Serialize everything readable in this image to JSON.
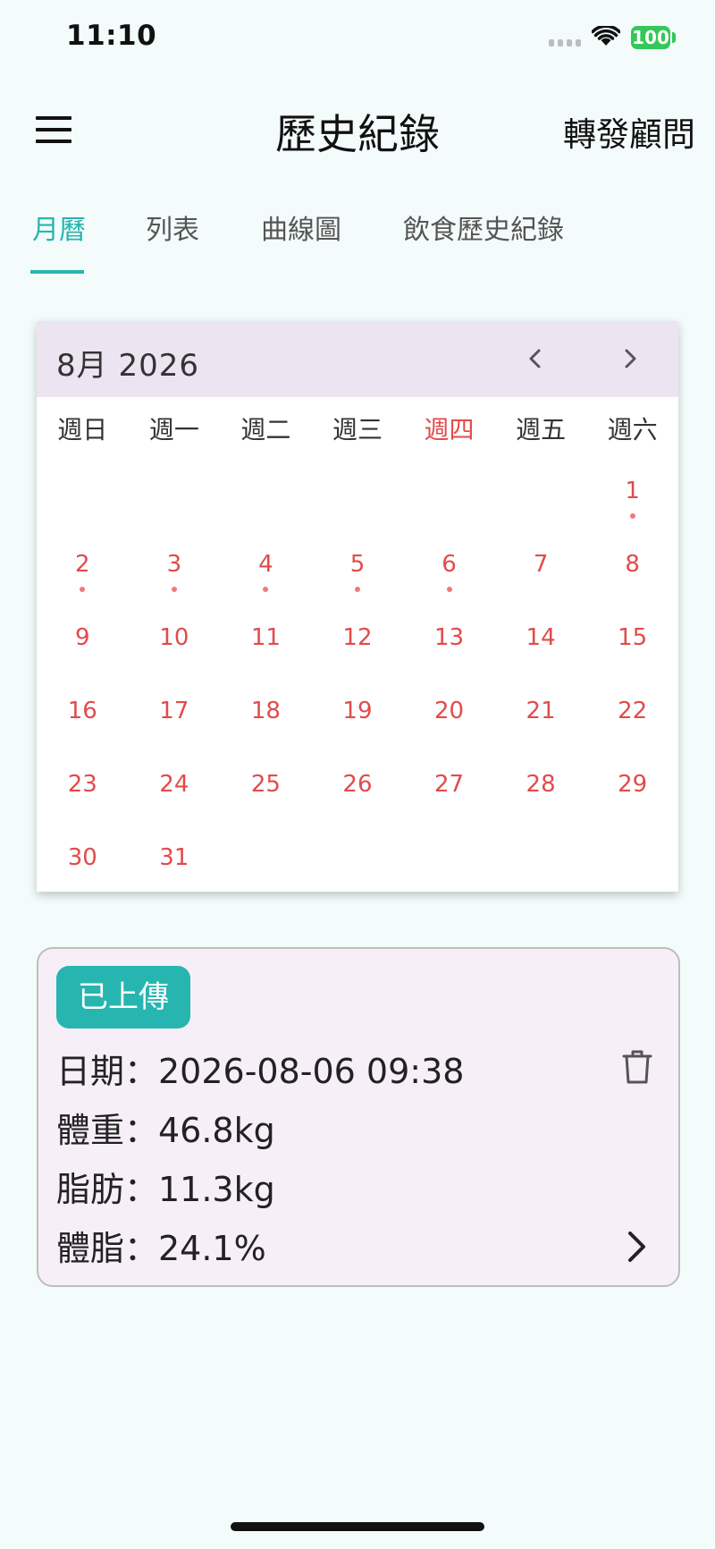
{
  "status_bar": {
    "time": "11:10",
    "battery": "100"
  },
  "app_bar": {
    "title": "歷史紀錄",
    "action": "轉發顧問",
    "menu_icon": "hamburger-menu-icon"
  },
  "tabs": [
    {
      "label": "月曆",
      "active": true
    },
    {
      "label": "列表",
      "active": false
    },
    {
      "label": "曲線圖",
      "active": false
    },
    {
      "label": "飲食歷史紀錄",
      "active": false
    }
  ],
  "calendar": {
    "month_label": "8月 2026",
    "prev_icon": "chevron-left-icon",
    "next_icon": "chevron-right-icon",
    "weekdays": [
      {
        "label": "週日",
        "today": false
      },
      {
        "label": "週一",
        "today": false
      },
      {
        "label": "週二",
        "today": false
      },
      {
        "label": "週三",
        "today": false
      },
      {
        "label": "週四",
        "today": true
      },
      {
        "label": "週五",
        "today": false
      },
      {
        "label": "週六",
        "today": false
      }
    ],
    "weeks": [
      [
        null,
        null,
        null,
        null,
        null,
        null,
        {
          "day": "1",
          "dot": true
        }
      ],
      [
        {
          "day": "2",
          "dot": true
        },
        {
          "day": "3",
          "dot": true
        },
        {
          "day": "4",
          "dot": true
        },
        {
          "day": "5",
          "dot": true
        },
        {
          "day": "6",
          "dot": true
        },
        {
          "day": "7",
          "dot": false
        },
        {
          "day": "8",
          "dot": false
        }
      ],
      [
        {
          "day": "9",
          "dot": false
        },
        {
          "day": "10",
          "dot": false
        },
        {
          "day": "11",
          "dot": false
        },
        {
          "day": "12",
          "dot": false
        },
        {
          "day": "13",
          "dot": false
        },
        {
          "day": "14",
          "dot": false
        },
        {
          "day": "15",
          "dot": false
        }
      ],
      [
        {
          "day": "16",
          "dot": false
        },
        {
          "day": "17",
          "dot": false
        },
        {
          "day": "18",
          "dot": false
        },
        {
          "day": "19",
          "dot": false
        },
        {
          "day": "20",
          "dot": false
        },
        {
          "day": "21",
          "dot": false
        },
        {
          "day": "22",
          "dot": false
        }
      ],
      [
        {
          "day": "23",
          "dot": false
        },
        {
          "day": "24",
          "dot": false
        },
        {
          "day": "25",
          "dot": false
        },
        {
          "day": "26",
          "dot": false
        },
        {
          "day": "27",
          "dot": false
        },
        {
          "day": "28",
          "dot": false
        },
        {
          "day": "29",
          "dot": false
        }
      ],
      [
        {
          "day": "30",
          "dot": false
        },
        {
          "day": "31",
          "dot": false
        },
        null,
        null,
        null,
        null,
        null
      ]
    ]
  },
  "record": {
    "badge": "已上傳",
    "date_line": "日期：2026-08-06 09:38",
    "weight_line": "體重：46.8kg",
    "fat_line": "脂肪：11.3kg",
    "body_fat_line": "體脂：24.1%",
    "delete_icon": "trash-icon",
    "detail_icon": "chevron-right-icon"
  },
  "colors": {
    "accent": "#26B6AF",
    "calendar_day": "#E24B4B",
    "event_dot": "#F0797B",
    "calendar_header_bg": "#ECE5F1",
    "card_bg": "#F6EFF8",
    "page_bg": "#F3FCFB"
  }
}
